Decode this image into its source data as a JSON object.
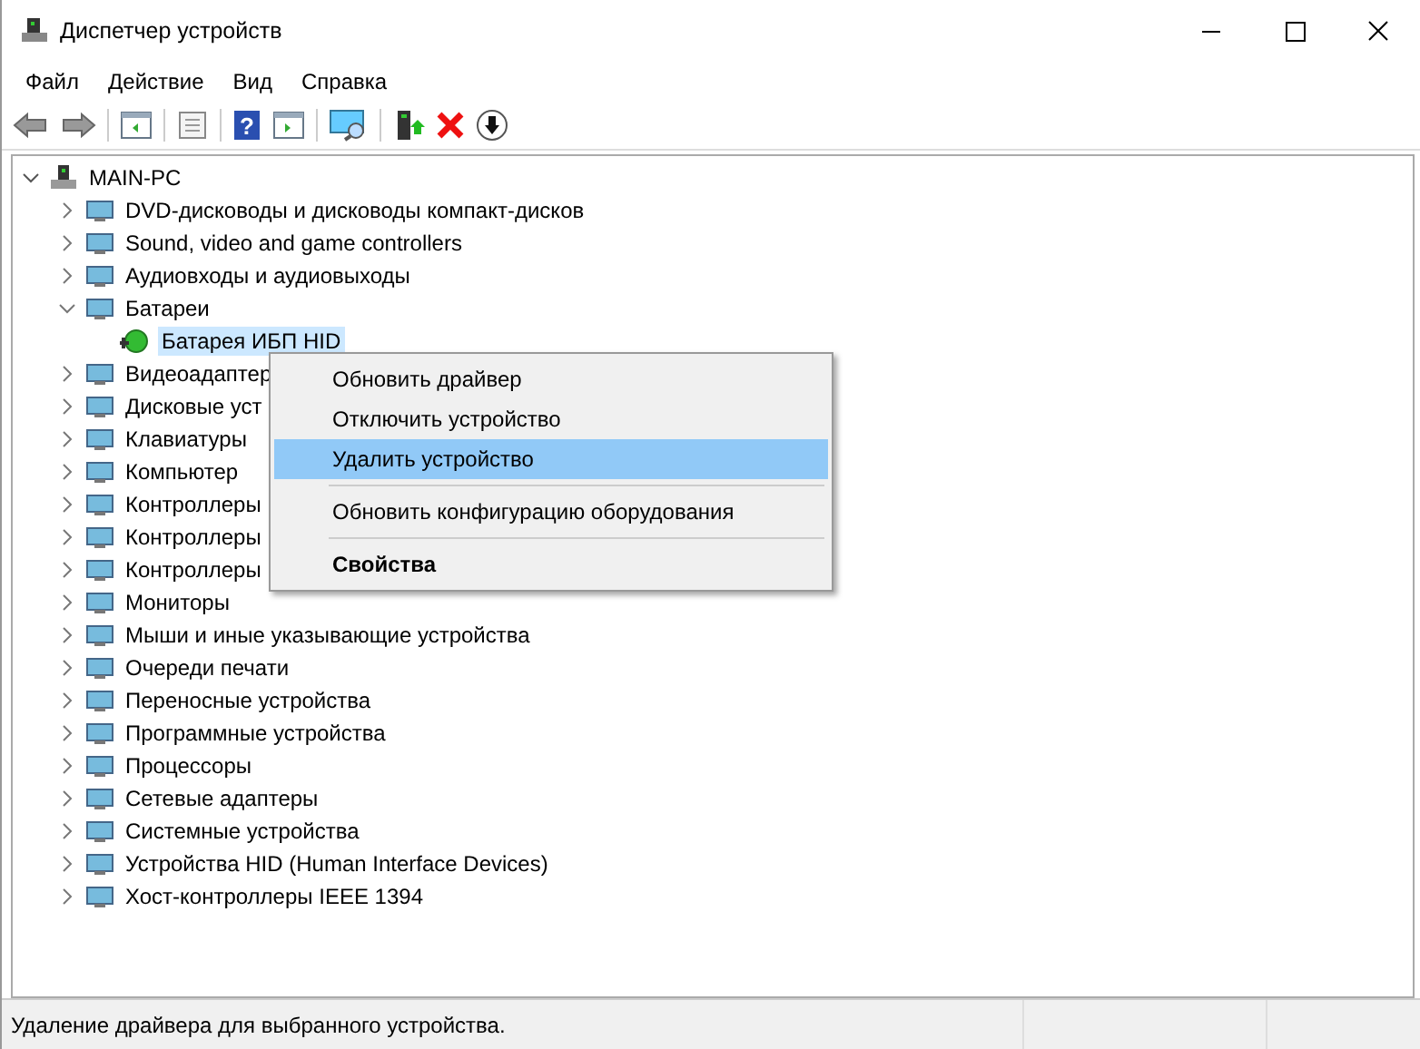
{
  "window": {
    "title": "Диспетчер устройств"
  },
  "menu_bar": [
    "Файл",
    "Действие",
    "Вид",
    "Справка"
  ],
  "toolbar": [
    {
      "kind": "back",
      "disabled": false
    },
    {
      "kind": "forward",
      "disabled": false
    },
    {
      "kind": "sep"
    },
    {
      "kind": "panel"
    },
    {
      "kind": "sep"
    },
    {
      "kind": "props"
    },
    {
      "kind": "sep"
    },
    {
      "kind": "help",
      "glyph": "?"
    },
    {
      "kind": "panel2"
    },
    {
      "kind": "sep"
    },
    {
      "kind": "scan"
    },
    {
      "kind": "sep"
    },
    {
      "kind": "add"
    },
    {
      "kind": "remove"
    },
    {
      "kind": "down"
    }
  ],
  "tree": {
    "label": "MAIN-PC",
    "expanded": true,
    "children": [
      {
        "label": "DVD-дисководы и дисководы компакт-дисков",
        "expanded": false
      },
      {
        "label": "Sound, video and game controllers",
        "expanded": false
      },
      {
        "label": "Аудиовходы и аудиовыходы",
        "expanded": false
      },
      {
        "label": "Батареи",
        "expanded": true,
        "children": [
          {
            "label": "Батарея ИБП HID",
            "selected": true
          }
        ]
      },
      {
        "label": "Видеоадаптер",
        "expanded": false
      },
      {
        "label": "Дисковые уст",
        "expanded": false
      },
      {
        "label": "Клавиатуры",
        "expanded": false
      },
      {
        "label": "Компьютер",
        "expanded": false
      },
      {
        "label": "Контроллеры",
        "expanded": false
      },
      {
        "label": "Контроллеры",
        "expanded": false
      },
      {
        "label": "Контроллеры",
        "expanded": false
      },
      {
        "label": "Мониторы",
        "expanded": false
      },
      {
        "label": "Мыши и иные указывающие устройства",
        "expanded": false
      },
      {
        "label": "Очереди печати",
        "expanded": false
      },
      {
        "label": "Переносные устройства",
        "expanded": false
      },
      {
        "label": "Программные устройства",
        "expanded": false
      },
      {
        "label": "Процессоры",
        "expanded": false
      },
      {
        "label": "Сетевые адаптеры",
        "expanded": false
      },
      {
        "label": "Системные устройства",
        "expanded": false
      },
      {
        "label": "Устройства HID (Human Interface Devices)",
        "expanded": false
      },
      {
        "label": "Хост-контроллеры IEEE 1394",
        "expanded": false
      }
    ]
  },
  "context_menu": [
    {
      "kind": "item",
      "label": "Обновить драйвер",
      "selected": false
    },
    {
      "kind": "item",
      "label": "Отключить устройство",
      "selected": false
    },
    {
      "kind": "item",
      "label": "Удалить устройство",
      "selected": true
    },
    {
      "kind": "separator"
    },
    {
      "kind": "item",
      "label": "Обновить конфигурацию оборудования",
      "selected": false
    },
    {
      "kind": "separator"
    },
    {
      "kind": "default",
      "label": "Свойства",
      "selected": false
    }
  ],
  "status_bar": "Удаление драйвера для выбранного устройства."
}
